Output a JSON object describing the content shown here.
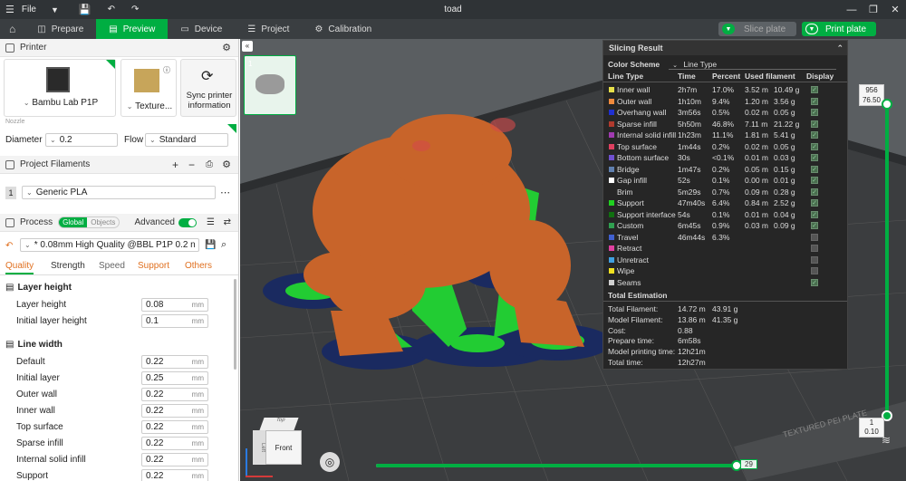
{
  "window": {
    "title": "toad",
    "file_menu": "File"
  },
  "nav": {
    "tabs": [
      {
        "label": "Prepare"
      },
      {
        "label": "Preview"
      },
      {
        "label": "Device"
      },
      {
        "label": "Project"
      },
      {
        "label": "Calibration"
      }
    ],
    "slice_plate": "Slice plate",
    "print_plate": "Print plate"
  },
  "printer": {
    "section": "Printer",
    "name": "Bambu Lab P1P",
    "plate": "Texture...",
    "sync_label_1": "Sync printer",
    "sync_label_2": "information",
    "nozzle_label": "Nozzle",
    "diameter_label": "Diameter",
    "diameter_value": "0.2",
    "flow_label": "Flow",
    "flow_value": "Standard"
  },
  "filaments": {
    "section": "Project Filaments",
    "items": [
      {
        "index": "1",
        "name": "Generic PLA"
      }
    ]
  },
  "process": {
    "section": "Process",
    "toggle_global": "Global",
    "toggle_objects": "Objects",
    "advanced": "Advanced",
    "preset": "* 0.08mm High Quality @BBL P1P 0.2 n...",
    "tabs": [
      "Quality",
      "Strength",
      "Speed",
      "Support",
      "Others"
    ],
    "groups": [
      {
        "title": "Layer height",
        "rows": [
          {
            "label": "Layer height",
            "value": "0.08",
            "unit": "mm"
          },
          {
            "label": "Initial layer height",
            "value": "0.1",
            "unit": "mm"
          }
        ]
      },
      {
        "title": "Line width",
        "rows": [
          {
            "label": "Default",
            "value": "0.22",
            "unit": "mm"
          },
          {
            "label": "Initial layer",
            "value": "0.25",
            "unit": "mm"
          },
          {
            "label": "Outer wall",
            "value": "0.22",
            "unit": "mm"
          },
          {
            "label": "Inner wall",
            "value": "0.22",
            "unit": "mm"
          },
          {
            "label": "Top surface",
            "value": "0.22",
            "unit": "mm"
          },
          {
            "label": "Sparse infill",
            "value": "0.22",
            "unit": "mm"
          },
          {
            "label": "Internal solid infill",
            "value": "0.22",
            "unit": "mm"
          },
          {
            "label": "Support",
            "value": "0.22",
            "unit": "mm"
          }
        ]
      }
    ]
  },
  "plate_thumb": {
    "number": "1"
  },
  "slicing_result": {
    "title": "Slicing Result",
    "color_scheme_label": "Color Scheme",
    "color_scheme_value": "Line Type",
    "columns": [
      "Line Type",
      "Time",
      "Percent",
      "Used filament",
      "Display"
    ],
    "rows": [
      {
        "name": "Inner wall",
        "time": "2h7m",
        "percent": "17.0%",
        "len": "3.52 m",
        "weight": "10.49 g",
        "color": "#e6e04a",
        "display": true
      },
      {
        "name": "Outer wall",
        "time": "1h10m",
        "percent": "9.4%",
        "len": "1.20 m",
        "weight": "3.56 g",
        "color": "#f08a3c",
        "display": true
      },
      {
        "name": "Overhang wall",
        "time": "3m56s",
        "percent": "0.5%",
        "len": "0.02 m",
        "weight": "0.05 g",
        "color": "#2030d0",
        "display": true
      },
      {
        "name": "Sparse infill",
        "time": "5h50m",
        "percent": "46.8%",
        "len": "7.11 m",
        "weight": "21.22 g",
        "color": "#b03a2e",
        "display": true
      },
      {
        "name": "Internal solid infill",
        "time": "1h23m",
        "percent": "11.1%",
        "len": "1.81 m",
        "weight": "5.41 g",
        "color": "#a03ab0",
        "display": true
      },
      {
        "name": "Top surface",
        "time": "1m44s",
        "percent": "0.2%",
        "len": "0.02 m",
        "weight": "0.05 g",
        "color": "#e04060",
        "display": true
      },
      {
        "name": "Bottom surface",
        "time": "30s",
        "percent": "<0.1%",
        "len": "0.01 m",
        "weight": "0.03 g",
        "color": "#7050d0",
        "display": true
      },
      {
        "name": "Bridge",
        "time": "1m47s",
        "percent": "0.2%",
        "len": "0.05 m",
        "weight": "0.15 g",
        "color": "#6080b0",
        "display": true
      },
      {
        "name": "Gap infill",
        "time": "52s",
        "percent": "0.1%",
        "len": "0.00 m",
        "weight": "0.01 g",
        "color": "#ffffff",
        "display": true
      },
      {
        "name": "Brim",
        "time": "5m29s",
        "percent": "0.7%",
        "len": "0.09 m",
        "weight": "0.28 g",
        "color": "#262626",
        "display": true
      },
      {
        "name": "Support",
        "time": "47m40s",
        "percent": "6.4%",
        "len": "0.84 m",
        "weight": "2.52 g",
        "color": "#20d020",
        "display": true
      },
      {
        "name": "Support interface",
        "time": "54s",
        "percent": "0.1%",
        "len": "0.01 m",
        "weight": "0.04 g",
        "color": "#107010",
        "display": true
      },
      {
        "name": "Custom",
        "time": "6m45s",
        "percent": "0.9%",
        "len": "0.03 m",
        "weight": "0.09 g",
        "color": "#30a050",
        "display": true
      },
      {
        "name": "Travel",
        "time": "46m44s",
        "percent": "6.3%",
        "len": "",
        "weight": "",
        "color": "#4060d0",
        "display": false
      },
      {
        "name": "Retract",
        "time": "",
        "percent": "",
        "len": "",
        "weight": "",
        "color": "#e040a0",
        "display": false
      },
      {
        "name": "Unretract",
        "time": "",
        "percent": "",
        "len": "",
        "weight": "",
        "color": "#40a0e0",
        "display": false
      },
      {
        "name": "Wipe",
        "time": "",
        "percent": "",
        "len": "",
        "weight": "",
        "color": "#f0e020",
        "display": false
      },
      {
        "name": "Seams",
        "time": "",
        "percent": "",
        "len": "",
        "weight": "",
        "color": "#d0d0d0",
        "display": true
      }
    ],
    "total_title": "Total Estimation",
    "totals": [
      {
        "label": "Total Filament:",
        "v1": "14.72 m",
        "v2": "43.91 g"
      },
      {
        "label": "Model Filament:",
        "v1": "13.86 m",
        "v2": "41.35 g"
      },
      {
        "label": "Cost:",
        "v1": "0.88",
        "v2": ""
      },
      {
        "label": "Prepare time:",
        "v1": "6m58s",
        "v2": ""
      },
      {
        "label": "Model printing time:",
        "v1": "12h21m",
        "v2": ""
      },
      {
        "label": "Total time:",
        "v1": "12h27m",
        "v2": ""
      }
    ]
  },
  "layer_slider": {
    "top_a": "956",
    "top_b": "76.50",
    "bottom_a": "1",
    "bottom_b": "0.10"
  },
  "move_slider": {
    "value": "29"
  },
  "view_cube": {
    "front": "Front",
    "top": "Top",
    "left": "Left"
  },
  "bed_text": "TEXTURED PEI PLATE",
  "colors": {
    "accent": "#00ae42",
    "model": "#c8642a",
    "support": "#22cc33",
    "brim": "#1a2a60"
  }
}
